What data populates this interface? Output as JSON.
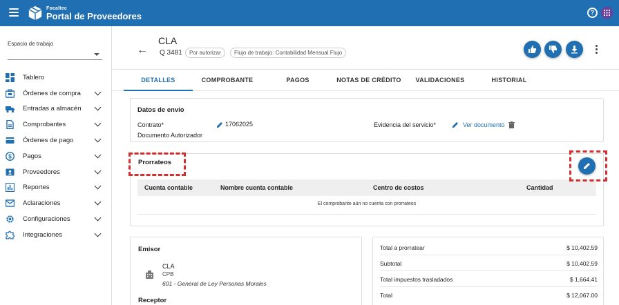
{
  "header": {
    "brand_small": "Focaltec",
    "brand_title": "Portal de Proveedores",
    "help_icon": "?",
    "colors": {
      "primary": "#1f6fb2",
      "accent_purple": "#6a3fa0",
      "highlight": "#d32f2f"
    }
  },
  "sidebar": {
    "workspace_label": "Espacio de trabajo",
    "workspace_value": "",
    "items": [
      {
        "label": "Tablero",
        "icon": "dashboard-icon",
        "expandable": false
      },
      {
        "label": "Órdenes de compra",
        "icon": "briefcase-icon",
        "expandable": true
      },
      {
        "label": "Entradas a almacén",
        "icon": "truck-icon",
        "expandable": true
      },
      {
        "label": "Comprobantes",
        "icon": "document-icon",
        "expandable": true
      },
      {
        "label": "Órdenes de pago",
        "icon": "credit-card-icon",
        "expandable": true
      },
      {
        "label": "Pagos",
        "icon": "dollar-circle-icon",
        "expandable": true
      },
      {
        "label": "Proveedores",
        "icon": "contacts-icon",
        "expandable": true
      },
      {
        "label": "Reportes",
        "icon": "bar-chart-icon",
        "expandable": true
      },
      {
        "label": "Aclaraciones",
        "icon": "mail-icon",
        "expandable": true
      },
      {
        "label": "Configuraciones",
        "icon": "gear-icon",
        "expandable": true
      },
      {
        "label": "Integraciones",
        "icon": "puzzle-icon",
        "expandable": true
      }
    ]
  },
  "doc": {
    "title": "CLA",
    "number": "Q 3481",
    "status_chip": "Por autorizar",
    "workflow_chip": "Flujo de trabajo: Contabilidad Mensual Flujo"
  },
  "tabs": [
    {
      "label": "DETALLES",
      "active": true
    },
    {
      "label": "COMPROBANTE",
      "active": false
    },
    {
      "label": "PAGOS",
      "active": false
    },
    {
      "label": "NOTAS DE CRÉDITO",
      "active": false
    },
    {
      "label": "VALIDACIONES",
      "active": false
    },
    {
      "label": "HISTORIAL",
      "active": false
    }
  ],
  "envio": {
    "title": "Datos de envío",
    "contrato_label": "Contrato*",
    "contrato_value": "17062025",
    "doc_autorizador_label": "Documento Autorizador",
    "evidencia_label": "Evidencia del servicio*",
    "ver_documento": "Ver documento"
  },
  "prorrateos": {
    "title": "Prorrateos",
    "columns": [
      "Cuenta contable",
      "Nombre cuenta contable",
      "Centro de costos",
      "Cantidad"
    ],
    "empty_message": "El comprobante aún no cuenta con prorrateos"
  },
  "emisor": {
    "title": "Emisor",
    "name": "CLA",
    "rfc": "CPB",
    "regimen": "601 - General de Ley Personas Morales",
    "receptor_title": "Receptor"
  },
  "totals": [
    {
      "label": "Total a prorratear",
      "value": "$ 10,402.59"
    },
    {
      "label": "Subtotal",
      "value": "$ 10,402.59"
    },
    {
      "label": "Total impuestos trasladados",
      "value": "$ 1,664.41"
    },
    {
      "label": "Total",
      "value": "$ 12,067.00"
    }
  ]
}
